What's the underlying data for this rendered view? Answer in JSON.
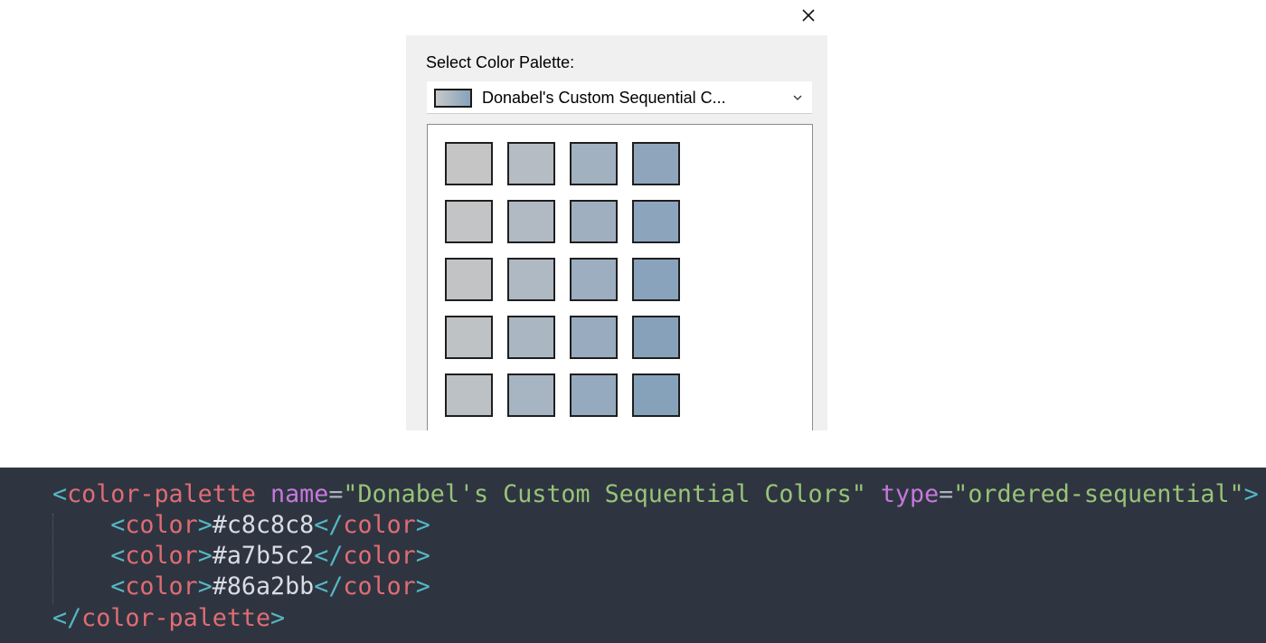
{
  "dialog": {
    "close_icon": "close-icon",
    "select_label": "Select Color Palette:",
    "dropdown": {
      "selected_value": "Donabel's Custom Sequential C...",
      "preview_colors": [
        "#c8c8c8",
        "#a7b5c2",
        "#86a2bb"
      ],
      "chevron_icon": "chevron-down-icon"
    },
    "swatches": [
      [
        "#c5c5c5",
        "#b5bcc3",
        "#a2b1c0",
        "#8fa5bc"
      ],
      [
        "#c3c4c5",
        "#b1bac3",
        "#9fafc0",
        "#8ca4bc"
      ],
      [
        "#c1c3c5",
        "#aeb9c3",
        "#9caec0",
        "#89a3bc"
      ],
      [
        "#bec2c5",
        "#aab7c2",
        "#99acbf",
        "#87a1bb"
      ],
      [
        "#bbc1c5",
        "#a7b5c2",
        "#96aabf",
        "#86a2bb"
      ]
    ]
  },
  "code": {
    "open_tag": "color-palette",
    "name_attr": "name",
    "name_value": "\"Donabel's Custom Sequential Colors\"",
    "type_attr": "type",
    "type_value": "\"ordered-sequential\"",
    "child_tag": "color",
    "colors": [
      "#c8c8c8",
      "#a7b5c2",
      "#86a2bb"
    ],
    "close_tag": "color-palette"
  }
}
